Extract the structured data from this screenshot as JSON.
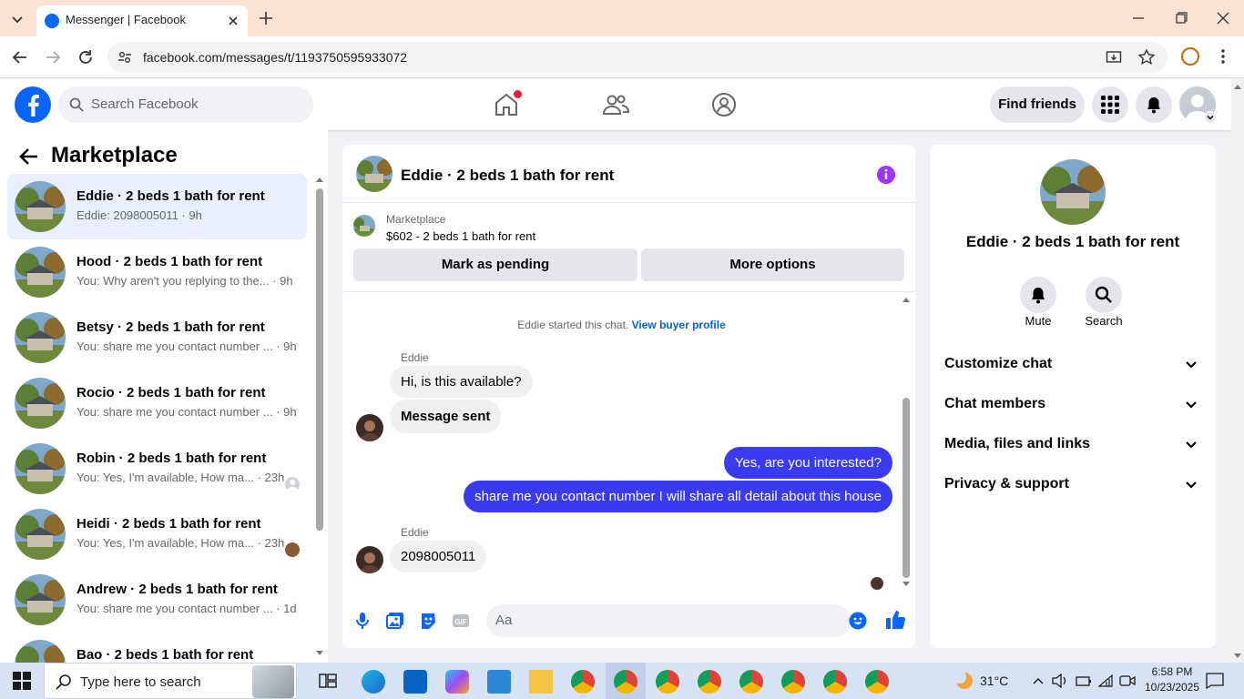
{
  "browser": {
    "tab_title": "Messenger | Facebook",
    "url": "facebook.com/messages/t/1193750595933072"
  },
  "header": {
    "search_placeholder": "Search Facebook",
    "find_friends": "Find friends"
  },
  "sidebar": {
    "title": "Marketplace",
    "conversations": [
      {
        "name": "Eddie · 2 beds 1 bath for rent",
        "snippet": "Eddie: 2098005011 · 9h",
        "selected": true
      },
      {
        "name": "Hood · 2 beds 1 bath for rent",
        "snippet": "You: Why aren't you replying to the... · 9h"
      },
      {
        "name": "Betsy · 2 beds 1 bath for rent",
        "snippet": "You: share me you contact number ... · 9h"
      },
      {
        "name": "Rocio · 2 beds 1 bath for rent",
        "snippet": "You: share me you contact number ... · 9h"
      },
      {
        "name": "Robin · 2 beds 1 bath for rent",
        "snippet": "You: Yes, I'm available, How ma... · 23h"
      },
      {
        "name": "Heidi · 2 beds 1 bath for rent",
        "snippet": "You: Yes, I'm available, How ma... · 23h"
      },
      {
        "name": "Andrew · 2 beds 1 bath for rent",
        "snippet": "You: share me you contact number ... · 1d"
      },
      {
        "name": "Bao · 2 beds 1 bath for rent",
        "snippet": ""
      }
    ]
  },
  "chat": {
    "title": "Eddie · 2 beds 1 bath for rent",
    "listing_source": "Marketplace",
    "listing": "$602 - 2 beds 1 bath for rent",
    "mark_pending": "Mark as pending",
    "more_options": "More options",
    "started_text": "Eddie started this chat.",
    "view_buyer": "View buyer profile",
    "messages": [
      {
        "sender": "Eddie",
        "text": "Hi, is this available?"
      },
      {
        "text": "Message sent"
      },
      {
        "text": "Yes, are you interested?"
      },
      {
        "text": "share me you contact number I will share all detail about this house"
      },
      {
        "sender": "Eddie",
        "text": "2098005011"
      }
    ],
    "composer_placeholder": "Aa"
  },
  "profile": {
    "name": "Eddie · 2 beds 1 bath for rent",
    "mute": "Mute",
    "search": "Search",
    "sections": [
      "Customize chat",
      "Chat members",
      "Media, files and links",
      "Privacy & support"
    ]
  },
  "taskbar": {
    "search_placeholder": "Type here to search",
    "temperature": "31°C",
    "time": "6:58 PM",
    "date": "10/23/2025"
  },
  "icons": [
    "windows-icon",
    "search-icon",
    "home-icon",
    "friends-icon",
    "groups-icon",
    "menu-grid-icon",
    "bell-icon",
    "info-icon",
    "mic-icon",
    "image-icon",
    "sticker-icon",
    "gif-icon",
    "emoji-icon",
    "thumbs-up-icon"
  ],
  "colors": {
    "fb_blue": "#0866ff",
    "outgoing_bubble": "#3a3bf0",
    "info_purple": "#a033ff"
  }
}
